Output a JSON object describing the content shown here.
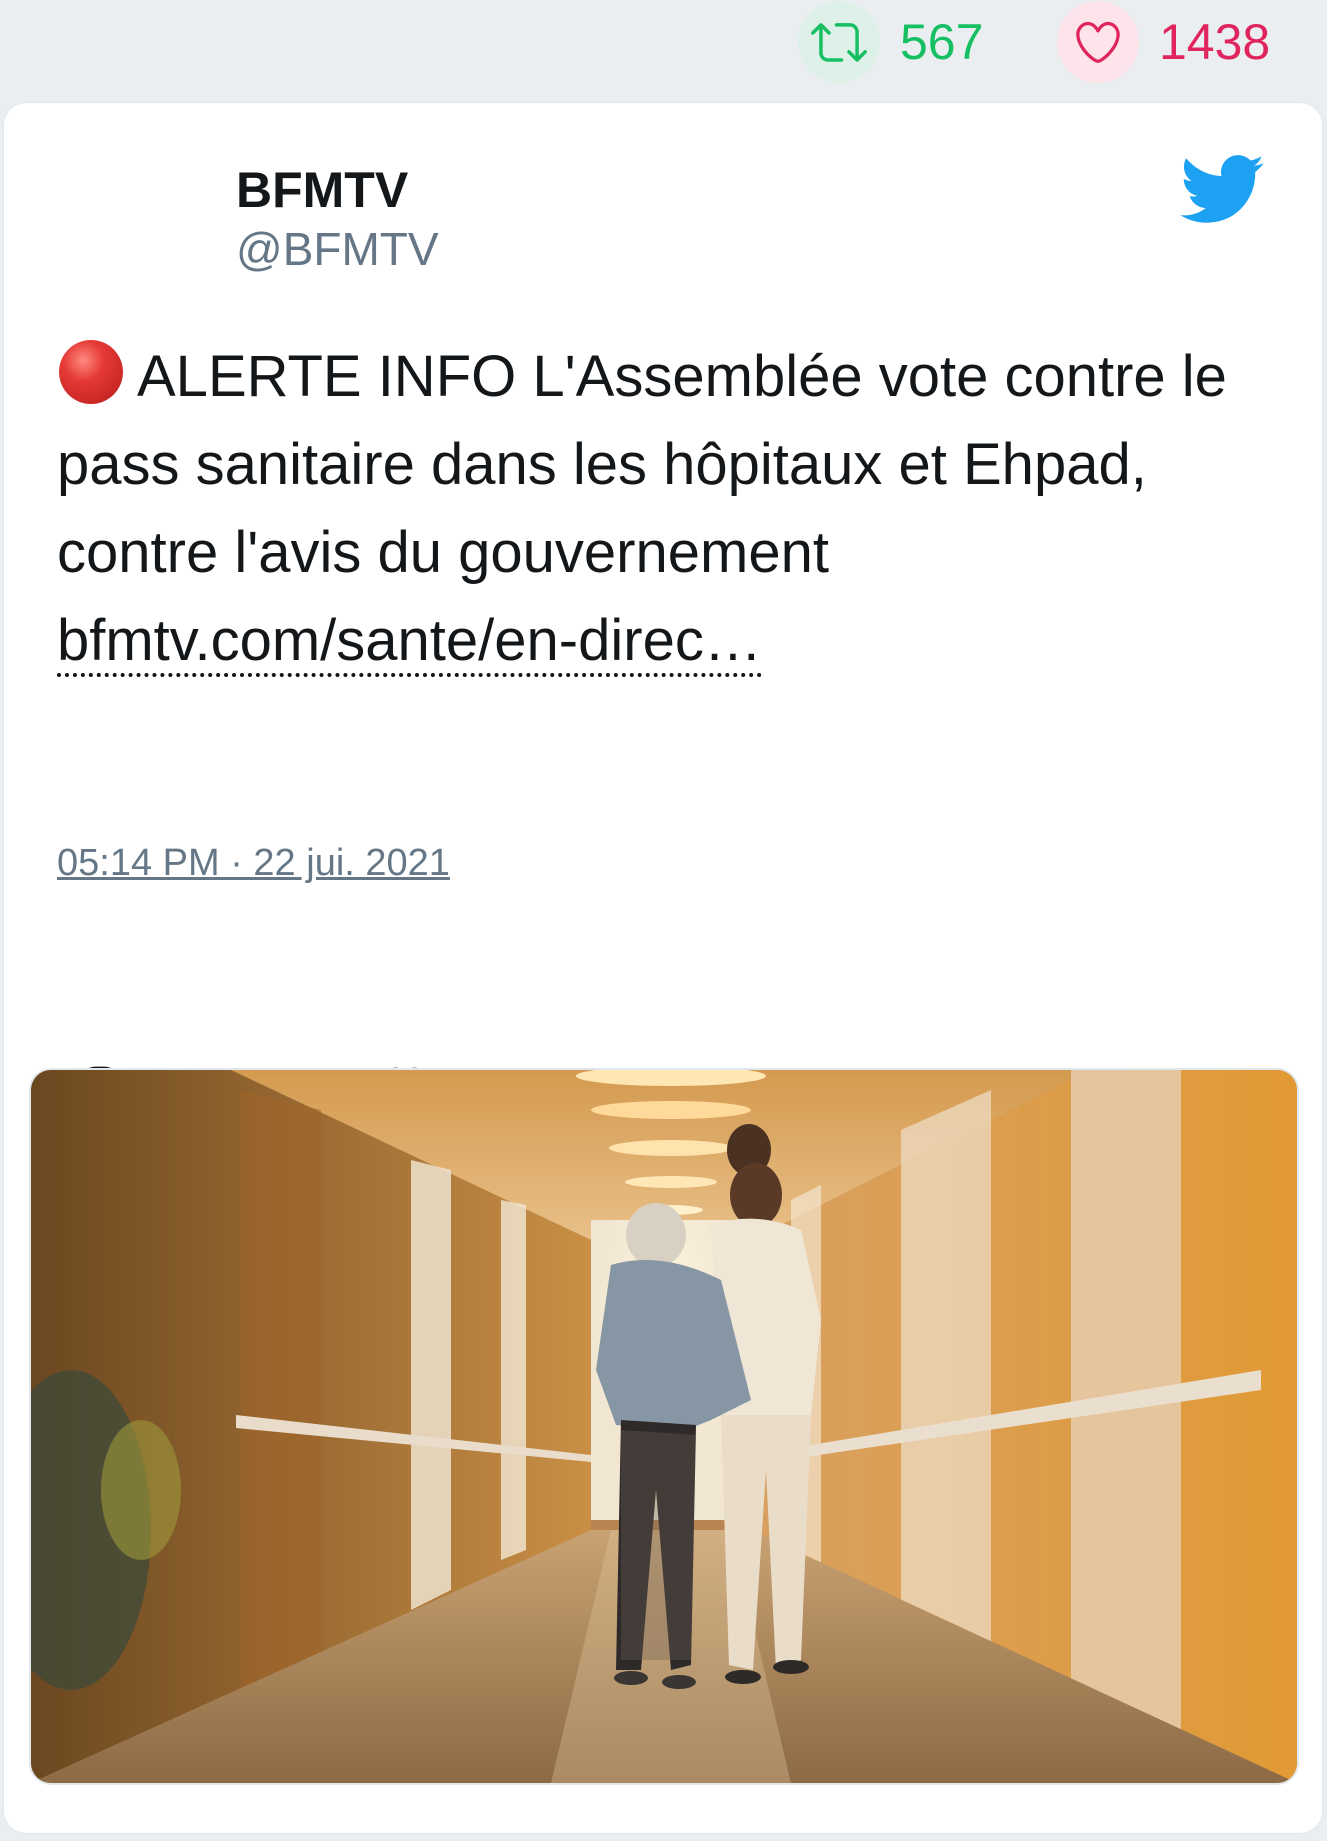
{
  "stats": {
    "retweets_count": "567",
    "likes_count": "1438"
  },
  "tweet": {
    "author_name": "BFMTV",
    "author_handle": "@BFMTV",
    "text": "ALERTE INFO L'Assemblée vote contre le pass sanitaire dans les hôpitaux et Ehpad, contre l'avis du gouvernement ",
    "link_text": "bfmtv.com/sante/en-direc…",
    "timestamp": "05:14 PM · 22 jui. 2021"
  },
  "colors": {
    "retweet_green": "#17bf63",
    "like_red": "#e0245e",
    "twitter_blue": "#1da1f2",
    "muted_text": "#657786"
  },
  "icons": {
    "retweet": "retweet-icon",
    "like": "heart-icon",
    "reply": "reply-icon",
    "brand": "twitter-bird-icon",
    "alert": "red-circle-emoji"
  }
}
